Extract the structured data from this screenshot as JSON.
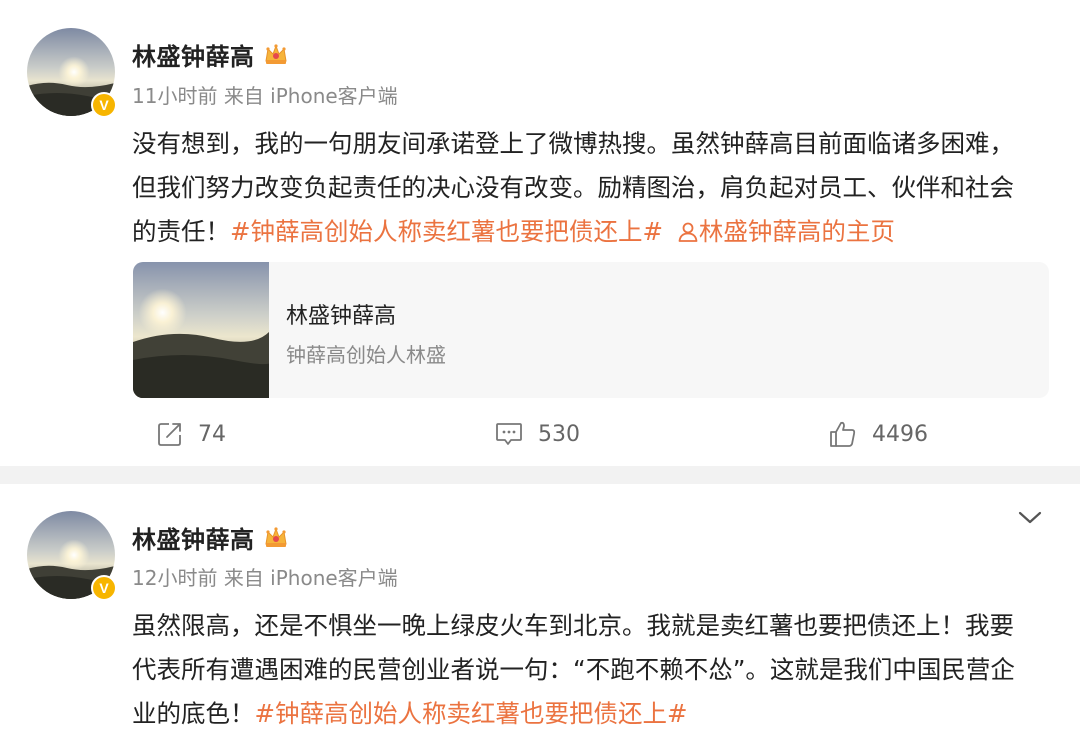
{
  "posts": [
    {
      "author": "林盛钟薛高",
      "time": "11小时前",
      "source": "来自 iPhone客户端",
      "text_line1": "没有想到，我的一句朋友间承诺登上了微博热搜。虽然钟薛高目前面临诸多困难，",
      "text_line2": "但我们努力改变负起责任的决心没有改变。励精图治，肩负起对员工、伙伴和社会",
      "text_line3_prefix": "的责任！",
      "topic": "#钟薛高创始人称卖红薯也要把债还上#",
      "profile_link": "林盛钟薛高的主页",
      "card": {
        "title": "林盛钟薛高",
        "subtitle": "钟薛高创始人林盛"
      },
      "actions": {
        "repost": "74",
        "comment": "530",
        "like": "4496"
      }
    },
    {
      "author": "林盛钟薛高",
      "time": "12小时前",
      "source": "来自 iPhone客户端",
      "text_line1": "虽然限高，还是不惧坐一晚上绿皮火车到北京。我就是卖红薯也要把债还上！我要",
      "text_line2": "代表所有遭遇困难的民营创业者说一句：“不跑不赖不怂”。这就是我们中国民营企",
      "text_line3_prefix": "业的底色！",
      "topic": "#钟薛高创始人称卖红薯也要把债还上#"
    }
  ],
  "colors": {
    "topic": "#eb7340",
    "meta": "#8a8a8a",
    "badge": "#f7b500",
    "divider": "#f2f2f2"
  },
  "icons": {
    "verified": "V",
    "crown": "crown-icon",
    "chevron": "chevron-down-icon",
    "repost": "repost-icon",
    "comment": "comment-icon",
    "like": "thumbs-up-icon",
    "profile": "user-icon"
  }
}
